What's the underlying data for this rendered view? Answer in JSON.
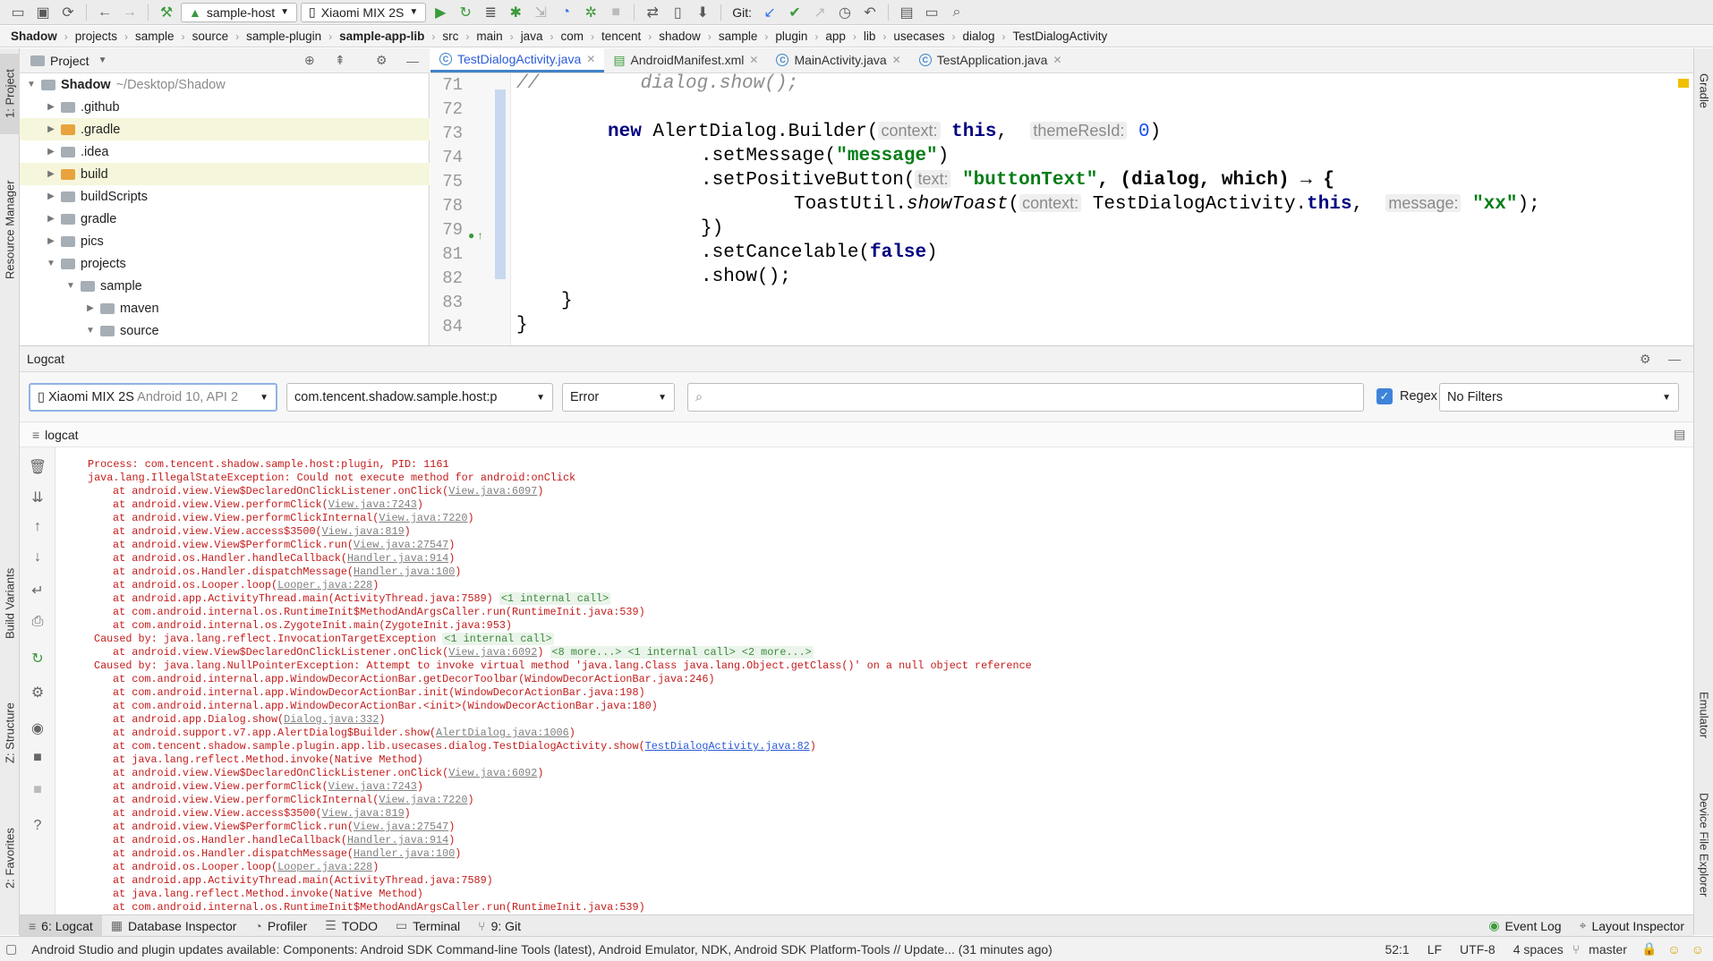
{
  "toolbar": {
    "run_config": "sample-host",
    "device": "Xiaomi MIX 2S",
    "git_label": "Git:"
  },
  "breadcrumb": [
    "Shadow",
    "projects",
    "sample",
    "source",
    "sample-plugin",
    "sample-app-lib",
    "src",
    "main",
    "java",
    "com",
    "tencent",
    "shadow",
    "sample",
    "plugin",
    "app",
    "lib",
    "usecases",
    "dialog",
    "TestDialogActivity"
  ],
  "left_stripe": {
    "project": "1: Project",
    "resource_manager": "Resource Manager",
    "build_variants": "Build Variants",
    "structure": "Z: Structure",
    "favorites": "2: Favorites"
  },
  "right_stripe": {
    "gradle": "Gradle",
    "emulator": "Emulator",
    "device_explorer": "Device File Explorer"
  },
  "project": {
    "title": "Project",
    "root_name": "Shadow",
    "root_path": "~/Desktop/Shadow",
    "items": [
      ".github",
      ".gradle",
      ".idea",
      "build",
      "buildScripts",
      "gradle",
      "pics",
      "projects",
      "sample",
      "maven",
      "source"
    ]
  },
  "editor": {
    "tabs": [
      "TestDialogActivity.java",
      "AndroidManifest.xml",
      "MainActivity.java",
      "TestApplication.java"
    ],
    "line_numbers": [
      "71",
      "72",
      "73",
      "74",
      "75",
      "78",
      "79",
      "81",
      "82",
      "83",
      "84"
    ],
    "code": {
      "l71_comment": "//         dialog.show();",
      "l73_new": "new",
      "l73_class": " AlertDialog.Builder(",
      "l73_hint1": "context:",
      "l73_this": "this",
      "l73_hint2": "themeResId:",
      "l73_zero": "0",
      "l73_close": ")",
      "l74_a": ".setMessage(",
      "l74_str": "\"message\"",
      "l74_b": ")",
      "l75_a": ".setPositiveButton(",
      "l75_hint": "text:",
      "l75_str": "\"buttonText\"",
      "l75_b": ", (dialog, which) → {",
      "l78_a": "ToastUtil.",
      "l78_method": "showToast",
      "l78_b": "(",
      "l78_hint1": "context:",
      "l78_c": "TestDialogActivity.",
      "l78_this": "this",
      "l78_d": ",",
      "l78_hint2": "message:",
      "l78_str": "\"xx\"",
      "l78_e": ");",
      "l79": "})",
      "l81_a": ".setCancelable(",
      "l81_false": "false",
      "l81_b": ")",
      "l82": ".show();",
      "l83": "}",
      "l84": "}"
    }
  },
  "logcat": {
    "title": "Logcat",
    "device_filter": "Xiaomi MIX 2S",
    "device_filter_sub": "Android 10, API 2",
    "process_filter": "com.tencent.shadow.sample.host:p",
    "level_filter": "Error",
    "search_placeholder": "",
    "regex_label": "Regex",
    "filters": "No Filters",
    "sub_tab": "logcat",
    "lines": [
      {
        "p": "Process: com.tencent.shadow.sample.host:plugin, PID: 1161",
        "i": 0
      },
      {
        "p": "java.lang.IllegalStateException: Could not execute method for android:onClick",
        "i": 0
      },
      {
        "p": "at android.view.View$DeclaredOnClickListener.onClick(",
        "l": "View.java:6097",
        "s": ")",
        "i": 2
      },
      {
        "p": "at android.view.View.performClick(",
        "l": "View.java:7243",
        "s": ")",
        "i": 2
      },
      {
        "p": "at android.view.View.performClickInternal(",
        "l": "View.java:7220",
        "s": ")",
        "i": 2
      },
      {
        "p": "at android.view.View.access$3500(",
        "l": "View.java:819",
        "s": ")",
        "i": 2
      },
      {
        "p": "at android.view.View$PerformClick.run(",
        "l": "View.java:27547",
        "s": ")",
        "i": 2
      },
      {
        "p": "at android.os.Handler.handleCallback(",
        "l": "Handler.java:914",
        "s": ")",
        "i": 2
      },
      {
        "p": "at android.os.Handler.dispatchMessage(",
        "l": "Handler.java:100",
        "s": ")",
        "i": 2
      },
      {
        "p": "at android.os.Looper.loop(",
        "l": "Looper.java:228",
        "s": ")",
        "i": 2
      },
      {
        "p": "at android.app.ActivityThread.main(ActivityThread.java:7589) ",
        "f": "<1 internal call>",
        "i": 2
      },
      {
        "p": "at com.android.internal.os.RuntimeInit$MethodAndArgsCaller.run(RuntimeInit.java:539)",
        "i": 2
      },
      {
        "p": "at com.android.internal.os.ZygoteInit.main(ZygoteInit.java:953)",
        "i": 2
      },
      {
        "p": "Caused by: java.lang.reflect.InvocationTargetException ",
        "f": "<1 internal call>",
        "i": 1
      },
      {
        "p": "at android.view.View$DeclaredOnClickListener.onClick(",
        "l": "View.java:6092",
        "s": ") ",
        "f": "<8 more...> <1 internal call> <2 more...>",
        "i": 2
      },
      {
        "p": "Caused by: java.lang.NullPointerException: Attempt to invoke virtual method 'java.lang.Class java.lang.Object.getClass()' on a null object reference",
        "i": 1
      },
      {
        "p": "at com.android.internal.app.WindowDecorActionBar.getDecorToolbar(WindowDecorActionBar.java:246)",
        "i": 2
      },
      {
        "p": "at com.android.internal.app.WindowDecorActionBar.init(WindowDecorActionBar.java:198)",
        "i": 2
      },
      {
        "p": "at com.android.internal.app.WindowDecorActionBar.<init>(WindowDecorActionBar.java:180)",
        "i": 2
      },
      {
        "p": "at android.app.Dialog.show(",
        "l": "Dialog.java:332",
        "s": ")",
        "i": 2
      },
      {
        "p": "at android.support.v7.app.AlertDialog$Builder.show(",
        "l": "AlertDialog.java:1006",
        "s": ")",
        "i": 2
      },
      {
        "p": "at com.tencent.shadow.sample.plugin.app.lib.usecases.dialog.TestDialogActivity.show(",
        "l": "TestDialogActivity.java:82",
        "s": ")",
        "i": 2,
        "blue": true
      },
      {
        "p": "at java.lang.reflect.Method.invoke(Native Method)",
        "i": 2
      },
      {
        "p": "at android.view.View$DeclaredOnClickListener.onClick(",
        "l": "View.java:6092",
        "s": ")",
        "i": 2
      },
      {
        "p": "at android.view.View.performClick(",
        "l": "View.java:7243",
        "s": ")",
        "i": 2
      },
      {
        "p": "at android.view.View.performClickInternal(",
        "l": "View.java:7220",
        "s": ")",
        "i": 2
      },
      {
        "p": "at android.view.View.access$3500(",
        "l": "View.java:819",
        "s": ")",
        "i": 2
      },
      {
        "p": "at android.view.View$PerformClick.run(",
        "l": "View.java:27547",
        "s": ")",
        "i": 2
      },
      {
        "p": "at android.os.Handler.handleCallback(",
        "l": "Handler.java:914",
        "s": ")",
        "i": 2
      },
      {
        "p": "at android.os.Handler.dispatchMessage(",
        "l": "Handler.java:100",
        "s": ")",
        "i": 2
      },
      {
        "p": "at android.os.Looper.loop(",
        "l": "Looper.java:228",
        "s": ")",
        "i": 2
      },
      {
        "p": "at android.app.ActivityThread.main(ActivityThread.java:7589)",
        "i": 2
      },
      {
        "p": "at java.lang.reflect.Method.invoke(Native Method)",
        "i": 2
      },
      {
        "p": "at com.android.internal.os.RuntimeInit$MethodAndArgsCaller.run(RuntimeInit.java:539)",
        "i": 2
      },
      {
        "p": "at com.android.internal.os.ZygoteInit.main(ZygoteInit.java:953)",
        "i": 2
      }
    ]
  },
  "tool_windows": [
    "6: Logcat",
    "Database Inspector",
    "Profiler",
    "TODO",
    "Terminal",
    "9: Git",
    "Event Log",
    "Layout Inspector"
  ],
  "status": {
    "message": "Android Studio and plugin updates available: Components: Android SDK Command-line Tools (latest), Android Emulator, NDK, Android SDK Platform-Tools // Update... (31 minutes ago)",
    "position": "52:1",
    "line_sep": "LF",
    "encoding": "UTF-8",
    "indent": "4 spaces",
    "branch": "master"
  }
}
